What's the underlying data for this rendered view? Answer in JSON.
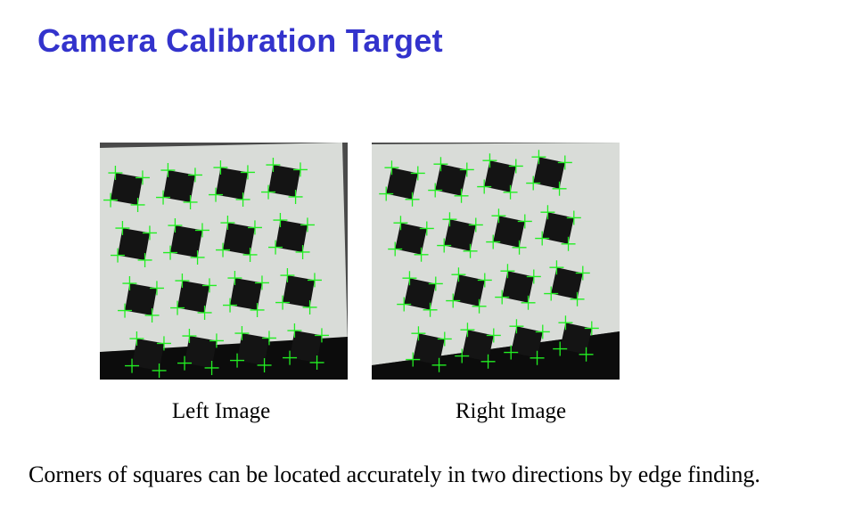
{
  "slide": {
    "title": "Camera Calibration Target",
    "title_color": "#3333cc"
  },
  "figures": {
    "left": {
      "caption": "Left Image",
      "board_rows": 4,
      "board_cols": 4
    },
    "right": {
      "caption": "Right Image",
      "board_rows": 4,
      "board_cols": 4
    },
    "marker_color": "#22ee22",
    "square_color": "#141414",
    "board_color": "#d9dcd8"
  },
  "body": {
    "text": "Corners of squares can be located accurately in two directions by edge finding."
  }
}
